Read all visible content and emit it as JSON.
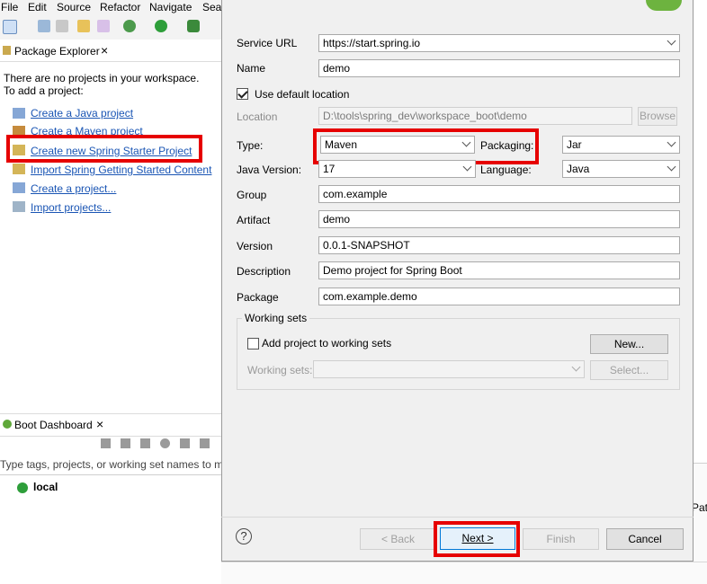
{
  "ide": {
    "menu": [
      "File",
      "Edit",
      "Source",
      "Refactor",
      "Navigate",
      "Sear"
    ],
    "package_explorer": {
      "tab_label": "Package Explorer",
      "message_line1": "There are no projects in your workspace.",
      "message_line2": "To add a project:",
      "links": [
        "Create a Java project",
        "Create a Maven project",
        "Create new Spring Starter Project",
        "Import Spring Getting Started Content",
        "Create a project...",
        "Import projects..."
      ]
    },
    "boot_dashboard": {
      "tab_label": "Boot Dashboard",
      "filter_placeholder": "Type tags, projects, or working set names to ma",
      "local_label": "local"
    },
    "right_partial_text": "Pat"
  },
  "dialog": {
    "service_url": {
      "label": "Service URL",
      "value": "https://start.spring.io"
    },
    "name": {
      "label": "Name",
      "value": "demo"
    },
    "use_default_location": {
      "label": "Use default location",
      "checked": true
    },
    "location": {
      "label": "Location",
      "value": "D:\\tools\\spring_dev\\workspace_boot\\demo",
      "browse_label": "Browse"
    },
    "type": {
      "label": "Type:",
      "value": "Maven"
    },
    "packaging": {
      "label": "Packaging:",
      "value": "Jar"
    },
    "java_version": {
      "label": "Java Version:",
      "value": "17"
    },
    "language": {
      "label": "Language:",
      "value": "Java"
    },
    "group": {
      "label": "Group",
      "value": "com.example"
    },
    "artifact": {
      "label": "Artifact",
      "value": "demo"
    },
    "version": {
      "label": "Version",
      "value": "0.0.1-SNAPSHOT"
    },
    "description": {
      "label": "Description",
      "value": "Demo project for Spring Boot"
    },
    "package": {
      "label": "Package",
      "value": "com.example.demo"
    },
    "working_sets": {
      "group_label": "Working sets",
      "add_label": "Add project to working sets",
      "new_label": "New...",
      "sets_label": "Working sets:",
      "select_label": "Select..."
    },
    "buttons": {
      "help": "?",
      "back": "< Back",
      "next": "Next >",
      "finish": "Finish",
      "cancel": "Cancel"
    }
  },
  "colors": {
    "highlight": "#e60000",
    "link": "#1a55b4",
    "spring_green": "#6db33f"
  }
}
